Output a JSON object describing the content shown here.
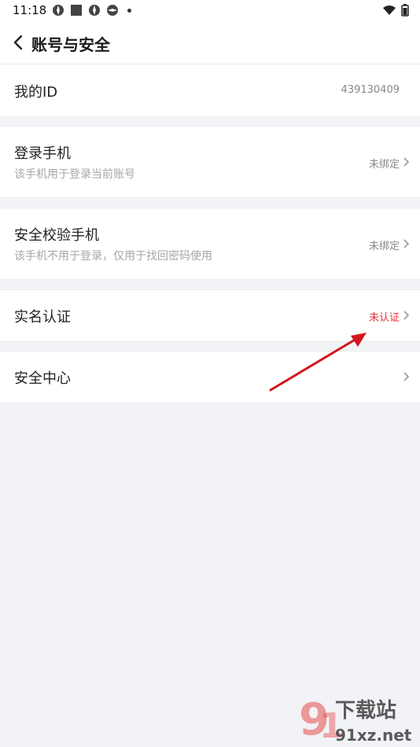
{
  "status": {
    "time": "11:18"
  },
  "header": {
    "title": "账号与安全"
  },
  "rows": [
    {
      "title": "我的ID",
      "value": "439130409"
    },
    {
      "title": "登录手机",
      "subtitle": "该手机用于登录当前账号",
      "value": "未绑定"
    },
    {
      "title": "安全校验手机",
      "subtitle": "该手机不用于登录，仅用于找回密码使用",
      "value": "未绑定"
    },
    {
      "title": "实名认证",
      "value": "未认证"
    },
    {
      "title": "安全中心"
    }
  ],
  "colors": {
    "accent_red": "#e5333d",
    "background": "#f1f3f6"
  },
  "watermark": {
    "brand": "下载站",
    "domain": "91xz.net"
  }
}
